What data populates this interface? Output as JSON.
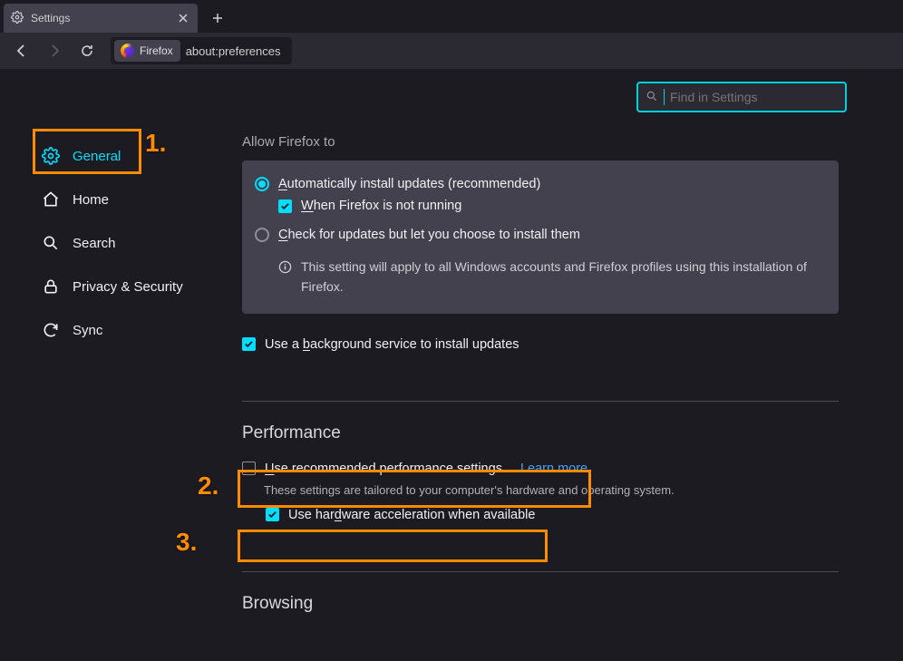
{
  "tab": {
    "title": "Settings"
  },
  "url": {
    "brand": "Firefox",
    "path": "about:preferences"
  },
  "search": {
    "placeholder": "Find in Settings"
  },
  "sidebar": {
    "items": [
      {
        "label": "General",
        "icon": "gear"
      },
      {
        "label": "Home",
        "icon": "home"
      },
      {
        "label": "Search",
        "icon": "search"
      },
      {
        "label": "Privacy & Security",
        "icon": "lock"
      },
      {
        "label": "Sync",
        "icon": "sync"
      }
    ]
  },
  "updates": {
    "heading_partial": "Allow Firefox to",
    "opt_auto": "utomatically install updates (recommended)",
    "opt_auto_key": "A",
    "sub_when": "hen Firefox is not running",
    "sub_when_key": "W",
    "opt_check": "heck for updates but let you choose to install them",
    "opt_check_key": "C",
    "info": "This setting will apply to all Windows accounts and Firefox profiles using this installation of Firefox.",
    "bg_service_pre": "Use a ",
    "bg_service_key": "b",
    "bg_service_post": "ackground service to install updates"
  },
  "performance": {
    "heading": "Performance",
    "rec_key": "U",
    "rec": "se recommended performance settings",
    "learn": "Learn more",
    "desc": "These settings are tailored to your computer's hardware and operating system.",
    "hw_pre": "Use har",
    "hw_key": "d",
    "hw_post": "ware acceleration when available"
  },
  "browsing": {
    "heading": "Browsing"
  },
  "annotations": {
    "n1": "1.",
    "n2": "2.",
    "n3": "3."
  }
}
